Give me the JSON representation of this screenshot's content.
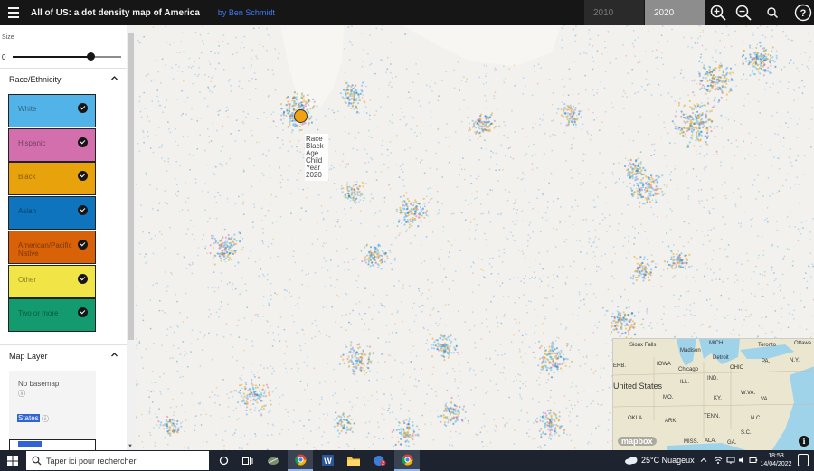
{
  "header": {
    "title": "All of US: a dot density map of America",
    "author": "by Ben Schmidt",
    "years": [
      "2010",
      "2020"
    ],
    "selected_year": "2020",
    "icons": [
      "menu-icon",
      "zoom-in-icon",
      "zoom-out-icon",
      "search-icon",
      "help-icon"
    ]
  },
  "sidebar": {
    "size_label": "Size",
    "slider_min": "0",
    "slider_value": 0.72,
    "race_section": "Race/Ethnicity",
    "race_items": [
      {
        "label": "White",
        "color": "#52b3e8"
      },
      {
        "label": "Hispanic",
        "color": "#d46fae"
      },
      {
        "label": "Black",
        "color": "#e8a20c"
      },
      {
        "label": "Asian",
        "color": "#0d74bd"
      },
      {
        "label": "American/Pacific Native",
        "color": "#d96209"
      },
      {
        "label": "Other",
        "color": "#f1e446"
      },
      {
        "label": "Two or more",
        "color": "#139b6f"
      }
    ],
    "layer_section": "Map Layer",
    "layers": {
      "no_basemap": "No basemap",
      "info_glyph": "ⓘ",
      "states": "States"
    }
  },
  "map": {
    "tooltip": [
      "Race",
      "Black",
      "Age",
      "Child",
      "Year",
      "2020"
    ],
    "minimap": {
      "country": "United States",
      "logo": "mapbox",
      "places": [
        {
          "name": "Sioux Falls",
          "l": 18,
          "t": 4
        },
        {
          "name": "Madison",
          "l": 74,
          "t": 10
        },
        {
          "name": "Detroit",
          "l": 110,
          "t": 18
        },
        {
          "name": "Toronto",
          "l": 160,
          "t": 4
        },
        {
          "name": "Ottawa",
          "l": 200,
          "t": 2
        },
        {
          "name": "ERB.",
          "l": 0,
          "t": 27
        },
        {
          "name": "IOWA",
          "l": 48,
          "t": 25
        },
        {
          "name": "Chicago",
          "l": 72,
          "t": 31
        },
        {
          "name": "MICH.",
          "l": 106,
          "t": 2
        },
        {
          "name": "OHIO",
          "l": 129,
          "t": 29
        },
        {
          "name": "PA.",
          "l": 164,
          "t": 22
        },
        {
          "name": "N.Y.",
          "l": 195,
          "t": 21
        },
        {
          "name": "ILL.",
          "l": 74,
          "t": 45
        },
        {
          "name": "IND.",
          "l": 104,
          "t": 41
        },
        {
          "name": "MO.",
          "l": 55,
          "t": 62
        },
        {
          "name": "KY.",
          "l": 111,
          "t": 63
        },
        {
          "name": "W.VA.",
          "l": 141,
          "t": 57
        },
        {
          "name": "VA.",
          "l": 163,
          "t": 64
        },
        {
          "name": "OKLA.",
          "l": 16,
          "t": 85
        },
        {
          "name": "ARK.",
          "l": 57,
          "t": 88
        },
        {
          "name": "TENN.",
          "l": 100,
          "t": 83
        },
        {
          "name": "N.C.",
          "l": 152,
          "t": 85
        },
        {
          "name": "S.C.",
          "l": 141,
          "t": 101
        },
        {
          "name": "MISS.",
          "l": 78,
          "t": 111
        },
        {
          "name": "ALA.",
          "l": 101,
          "t": 110
        },
        {
          "name": "GA.",
          "l": 126,
          "t": 112
        }
      ]
    }
  },
  "taskbar": {
    "search_placeholder": "Taper ici pour rechercher",
    "weather": "25°C  Nuageux",
    "time": "18:53",
    "date": "14/04/2022",
    "apps": [
      "windows-start-icon",
      "task-view-icon",
      "edge-like-icon",
      "chrome-icon",
      "word-icon",
      "explorer-icon",
      "teams-like-icon",
      "chrome-icon-2"
    ]
  }
}
